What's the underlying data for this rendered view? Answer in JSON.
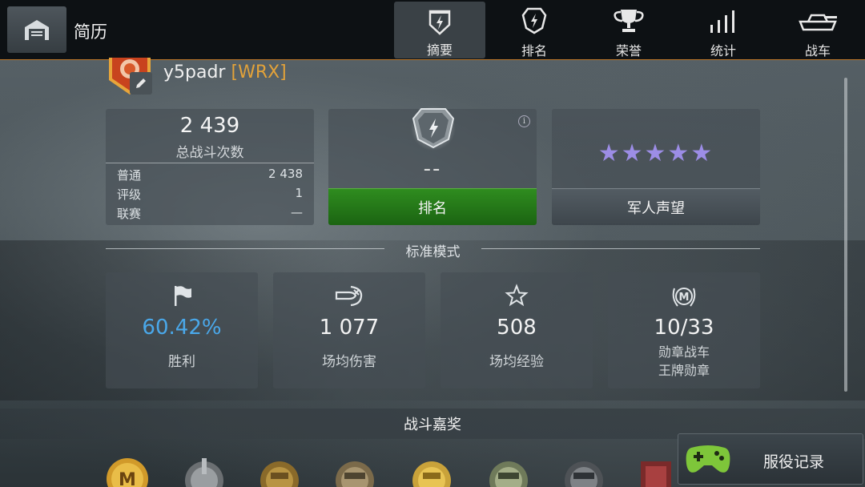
{
  "header": {
    "title": "简历",
    "tabs": [
      {
        "label": "摘要",
        "icon": "summary-shield-icon",
        "active": true
      },
      {
        "label": "排名",
        "icon": "rating-shield-icon",
        "active": false
      },
      {
        "label": "荣誉",
        "icon": "trophy-icon",
        "active": false
      },
      {
        "label": "统计",
        "icon": "bar-stats-icon",
        "active": false
      },
      {
        "label": "战车",
        "icon": "tank-icon",
        "active": false
      }
    ]
  },
  "player": {
    "name": "y5padr",
    "clan": "[WRX]"
  },
  "battles": {
    "total": "2 439",
    "label": "总战斗次数",
    "rows": [
      {
        "label": "普通",
        "value": "2 438"
      },
      {
        "label": "评级",
        "value": "1"
      },
      {
        "label": "联赛",
        "value": "—"
      }
    ]
  },
  "rank": {
    "value": "--",
    "button_label": "排名"
  },
  "reputation": {
    "stars": "★★★★★",
    "rating": 5,
    "button_label": "军人声望"
  },
  "mode": {
    "label": "标准模式"
  },
  "stats": [
    {
      "value": "60.42%",
      "label": "胜利",
      "label2": "",
      "icon": "flag-icon"
    },
    {
      "value": "1 077",
      "label": "场均伤害",
      "label2": "",
      "icon": "shell-damage-icon"
    },
    {
      "value": "508",
      "label": "场均经验",
      "label2": "",
      "icon": "star-outline-icon"
    },
    {
      "value": "10/33",
      "label": "勋章战车",
      "label2": "王牌勋章",
      "icon": "mastery-badge-icon"
    }
  ],
  "awards": {
    "title": "战斗嘉奖"
  },
  "service_record": {
    "label": "服役记录",
    "icon": "gamepad-icon"
  },
  "colors": {
    "accent_orange": "#e2a23a",
    "win_blue": "#4aa8ea",
    "rank_green": "#2f8c1f",
    "star_purple": "#9c8de6",
    "gamepad_green": "#7ec63a"
  }
}
